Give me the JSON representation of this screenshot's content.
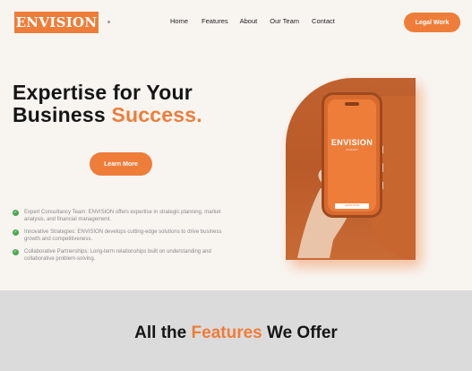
{
  "brand": {
    "logo": "ENVISION",
    "accent_color": "#ee7d3a"
  },
  "nav": {
    "items": [
      "Home",
      "Features",
      "About",
      "Our Team",
      "Contact"
    ],
    "cta": "Legal Work"
  },
  "hero": {
    "title_line1": "Expertise for Your",
    "title_line2_plain": "Business ",
    "title_line2_accent": "Success.",
    "button": "Learn More",
    "image_alt": "Hand holding a phone showing the ENVISION app",
    "phone": {
      "logo": "ENVISION",
      "tagline": "BUSINESS",
      "button": "LEARN MORE"
    }
  },
  "features_list": [
    "Expert Consultancy Team: ENVISION offers expertise in strategic planning, market analysis, and financial management.",
    "Innovative Strategies: ENVISION develops cutting-edge solutions to drive business growth and competitiveness.",
    "Collaborative Partnerships: Long-term relationships built on understanding and collaborative problem-solving."
  ],
  "features_section": {
    "heading_before": "All the ",
    "heading_accent": "Features",
    "heading_after": " We Offer"
  }
}
